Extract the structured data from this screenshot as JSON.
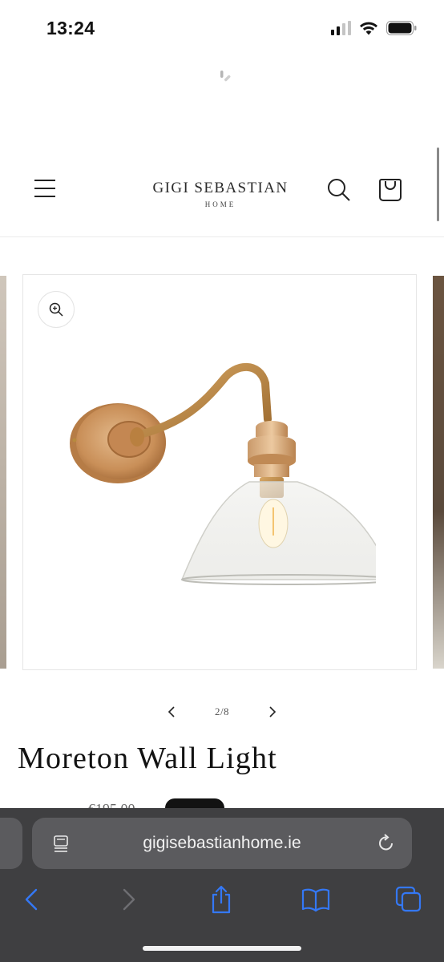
{
  "status_bar": {
    "time": "13:24"
  },
  "header": {
    "brand_name": "GIGI SEBASTIAN",
    "brand_sub": "HOME"
  },
  "gallery": {
    "pager": "2/8",
    "image_alt": "Moreton Wall Light with clear glass shade and wooden wall plate"
  },
  "product": {
    "title": "Moreton Wall Light",
    "price_partial": "€195.00"
  },
  "browser": {
    "url": "gigisebastianhome.ie",
    "accent_color": "#3478f6",
    "bar_color": "#3f3f41"
  }
}
